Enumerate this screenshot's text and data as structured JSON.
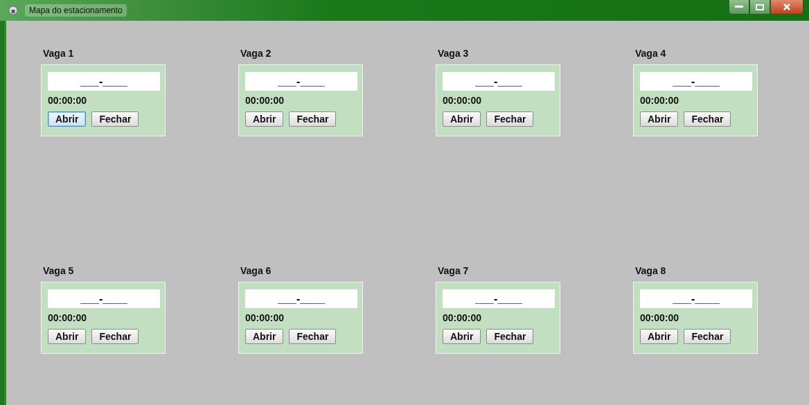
{
  "window": {
    "title": "Mapa do estacionamento"
  },
  "spots": [
    {
      "label": "Vaga 1",
      "plate": "___-____",
      "time": "00:00:00",
      "buttons": [
        {
          "label": "Abrir",
          "focused": true
        },
        {
          "label": "Fechar",
          "focused": false
        }
      ]
    },
    {
      "label": "Vaga 2",
      "plate": "___-____",
      "time": "00:00:00",
      "buttons": [
        {
          "label": "Abrir",
          "focused": false
        },
        {
          "label": "Fechar",
          "focused": false
        }
      ]
    },
    {
      "label": "Vaga 3",
      "plate": "___-____",
      "time": "00:00:00",
      "buttons": [
        {
          "label": "Abrir",
          "focused": false
        },
        {
          "label": "Fechar",
          "focused": false
        }
      ]
    },
    {
      "label": "Vaga 4",
      "plate": "___-____",
      "time": "00:00:00",
      "buttons": [
        {
          "label": "Abrir",
          "focused": false
        },
        {
          "label": "Fechar",
          "focused": false
        }
      ]
    },
    {
      "label": "Vaga 5",
      "plate": "___-____",
      "time": "00:00:00",
      "buttons": [
        {
          "label": "Abrir",
          "focused": false
        },
        {
          "label": "Fechar",
          "focused": false
        }
      ]
    },
    {
      "label": "Vaga 6",
      "plate": "___-____",
      "time": "00:00:00",
      "buttons": [
        {
          "label": "Abrir",
          "focused": false
        },
        {
          "label": "Fechar",
          "focused": false
        }
      ]
    },
    {
      "label": "Vaga 7",
      "plate": "___-____",
      "time": "00:00:00",
      "buttons": [
        {
          "label": "Abrir",
          "focused": false
        },
        {
          "label": "Fechar",
          "focused": false
        }
      ]
    },
    {
      "label": "Vaga 8",
      "plate": "___-____",
      "time": "00:00:00",
      "buttons": [
        {
          "label": "Abrir",
          "focused": false
        },
        {
          "label": "Fechar",
          "focused": false
        }
      ]
    }
  ]
}
